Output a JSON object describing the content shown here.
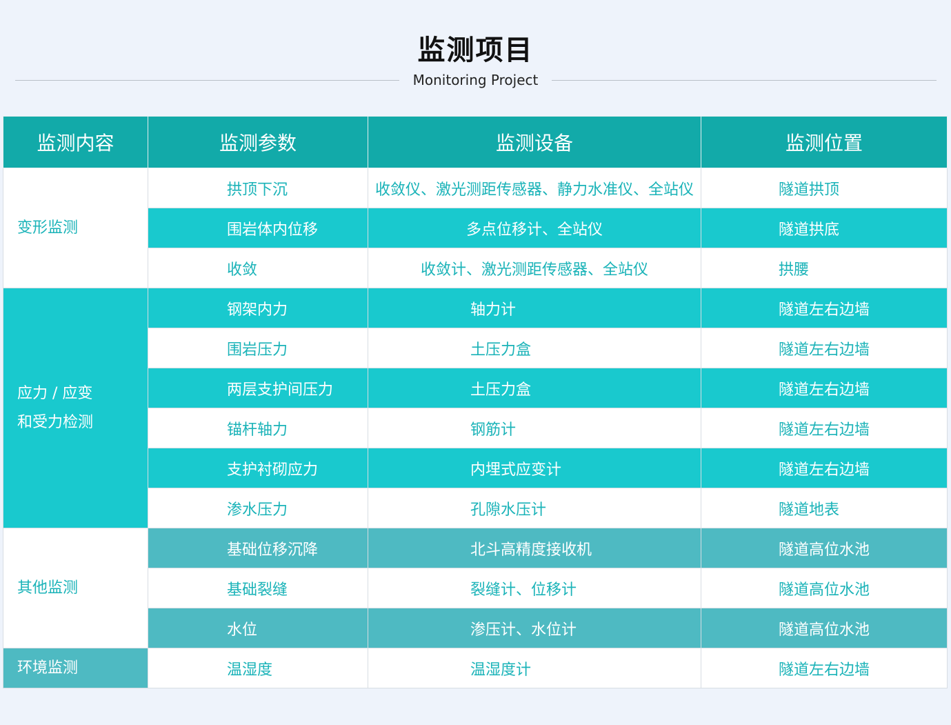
{
  "header": {
    "title": "监测项目",
    "subtitle": "Monitoring Project"
  },
  "table": {
    "columns": [
      "监测内容",
      "监测参数",
      "监测设备",
      "监测位置"
    ],
    "groups": [
      {
        "category": [
          "变形监测"
        ],
        "rows": [
          {
            "param": "拱顶下沉",
            "device": "收敛仪、激光测距传感器、静力水准仪、全站仪",
            "location": "隧道拱顶"
          },
          {
            "param": "围岩体内位移",
            "device": "多点位移计、全站仪",
            "location": "隧道拱底"
          },
          {
            "param": "收敛",
            "device": "收敛计、激光测距传感器、全站仪",
            "location": "拱腰"
          }
        ]
      },
      {
        "category": [
          "应力 / 应变",
          "和受力检测"
        ],
        "rows": [
          {
            "param": "钢架内力",
            "device": "轴力计",
            "location": "隧道左右边墙"
          },
          {
            "param": "围岩压力",
            "device": "土压力盒",
            "location": "隧道左右边墙"
          },
          {
            "param": "两层支护间压力",
            "device": "土压力盒",
            "location": "隧道左右边墙"
          },
          {
            "param": "锚杆轴力",
            "device": "钢筋计",
            "location": "隧道左右边墙"
          },
          {
            "param": "支护衬砌应力",
            "device": "内埋式应变计",
            "location": "隧道左右边墙"
          },
          {
            "param": "渗水压力",
            "device": "孔隙水压计",
            "location": "隧道地表"
          }
        ]
      },
      {
        "category": [
          "其他监测"
        ],
        "rows": [
          {
            "param": "基础位移沉降",
            "device": "北斗高精度接收机",
            "location": "隧道高位水池"
          },
          {
            "param": "基础裂缝",
            "device": "裂缝计、位移计",
            "location": "隧道高位水池"
          },
          {
            "param": "水位",
            "device": "渗压计、水位计",
            "location": "隧道高位水池"
          }
        ]
      },
      {
        "category": [
          "环境监测"
        ],
        "rows": [
          {
            "param": "温湿度",
            "device": "温湿度计",
            "location": "隧道左右边墙"
          }
        ]
      }
    ]
  },
  "colors": {
    "header_bg": "#12aaa9",
    "teal_row": "#19c9ce",
    "muted_row": "#4ebac2",
    "text_teal": "#1ab3b8",
    "page_bg": "#eef3fb"
  }
}
